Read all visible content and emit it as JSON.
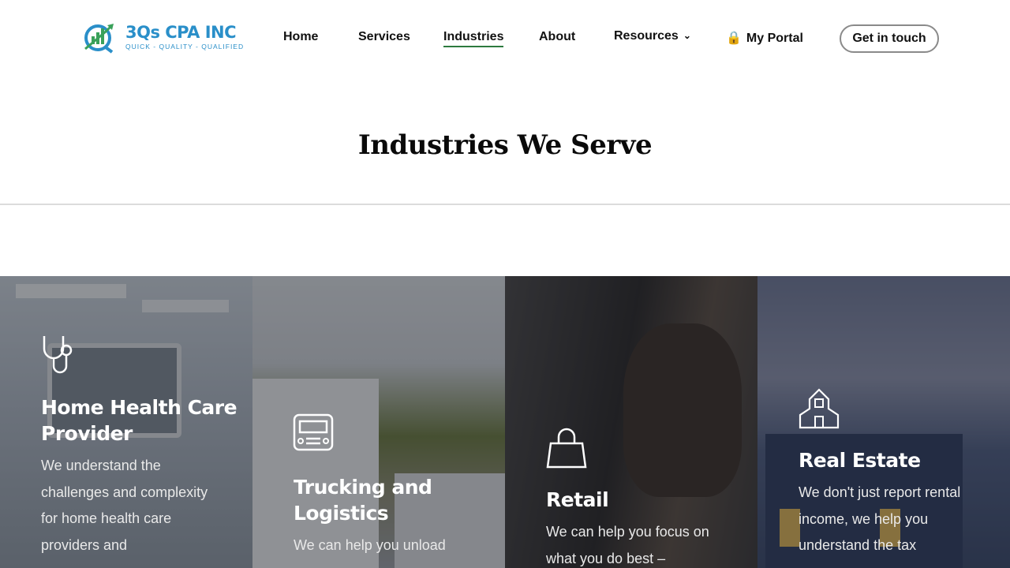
{
  "brand": {
    "name": "3Qs CPA INC",
    "tagline": "QUICK - QUALITY - QUALIFIED",
    "color": "#2a8fc9"
  },
  "nav": {
    "items": [
      {
        "label": "Home"
      },
      {
        "label": "Services"
      },
      {
        "label": "Industries",
        "active": true
      },
      {
        "label": "About"
      },
      {
        "label": "Resources"
      },
      {
        "label": "My Portal"
      }
    ],
    "cta_label": "Get in touch",
    "active_underline_color": "#2d7a3e"
  },
  "page": {
    "title": "Industries We Serve"
  },
  "industries": [
    {
      "icon": "stethoscope-icon",
      "title": "Home Health Care Provider",
      "text": "We understand the challenges and complexity for home health care providers and"
    },
    {
      "icon": "truck-icon",
      "title": "Trucking and Logistics",
      "text": "We can help you unload"
    },
    {
      "icon": "shopping-bag-icon",
      "title": "Retail",
      "text": "We can help you focus on what you do best –"
    },
    {
      "icon": "house-icon",
      "title": "Real Estate",
      "text": "We don't just report rental income, we help you understand the tax"
    }
  ]
}
